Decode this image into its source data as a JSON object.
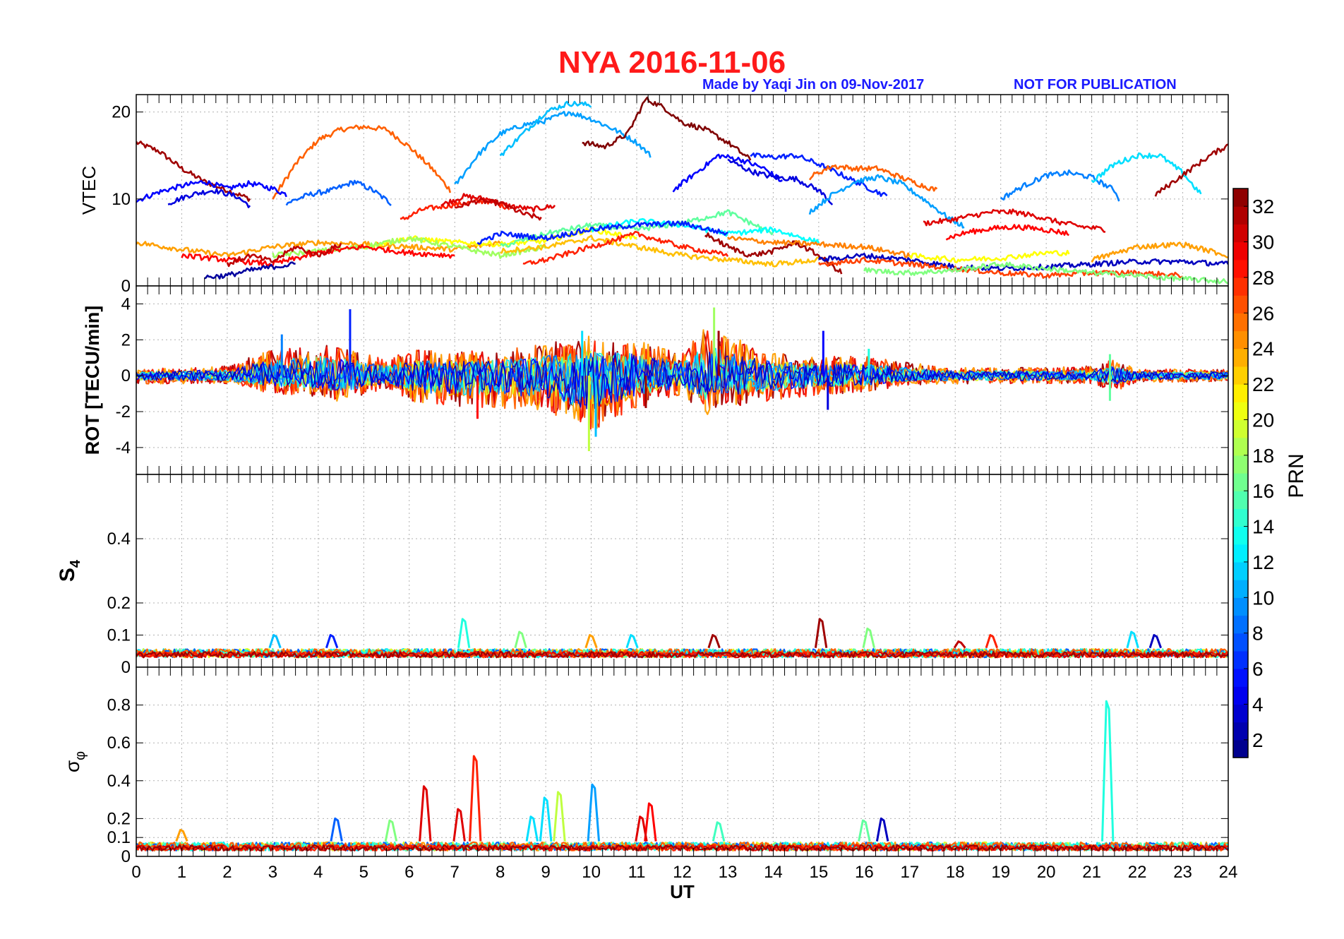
{
  "header": {
    "title": "NYA   2016-11-06",
    "credit": "Made by Yaqi Jin on 09-Nov-2017",
    "notice": "NOT FOR PUBLICATION"
  },
  "colors": {
    "title": "#ff1a1a",
    "credit": "#1a1aff",
    "grid": "#b0b0b0",
    "axis": "#000000"
  },
  "chart_data": [
    {
      "type": "line",
      "panel": "VTEC",
      "ylabel": "VTEC",
      "xlim": [
        0,
        24
      ],
      "ylim": [
        0,
        22
      ],
      "yticks": [
        0,
        10,
        20
      ],
      "grid": true,
      "series": [
        {
          "prn": 32,
          "x": [
            0,
            0.5,
            1,
            1.5,
            2,
            2.5
          ],
          "y": [
            16.5,
            15.5,
            13.5,
            12,
            11,
            10
          ]
        },
        {
          "prn": 26,
          "x": [
            3,
            3.5,
            4,
            4.5,
            5,
            5.5,
            6,
            6.5,
            6.9
          ],
          "y": [
            10,
            14,
            16.8,
            18,
            18.3,
            18,
            16,
            13.5,
            11
          ]
        },
        {
          "prn": 8,
          "x": [
            3.3,
            3.8,
            4.3,
            4.8,
            5.2,
            5.6
          ],
          "y": [
            9.5,
            10.5,
            11,
            12,
            11,
            9.5
          ]
        },
        {
          "prn": 5,
          "x": [
            0,
            0.5,
            1,
            1.5,
            2,
            2.5,
            3,
            3.3
          ],
          "y": [
            9.8,
            10.8,
            11.5,
            12,
            11.2,
            11.8,
            11.2,
            10.5
          ]
        },
        {
          "prn": 4,
          "x": [
            0.7,
            1.2,
            1.7,
            2.2,
            2.5
          ],
          "y": [
            9.5,
            10.5,
            11,
            10.3,
            9.2
          ]
        },
        {
          "prn": 28,
          "x": [
            5.8,
            6.3,
            6.8,
            7.2,
            7.7,
            8.2
          ],
          "y": [
            7.5,
            8.8,
            9.2,
            9.5,
            9.8,
            9
          ]
        },
        {
          "prn": 30,
          "x": [
            6.7,
            7.2,
            7.7,
            8.2,
            8.7,
            9.2
          ],
          "y": [
            9.3,
            10.3,
            10,
            9.2,
            8.8,
            9.2
          ]
        },
        {
          "prn": 31,
          "x": [
            7,
            7.5,
            8,
            8.5,
            8.9
          ],
          "y": [
            9,
            9.8,
            9.5,
            8.3,
            7.8
          ]
        },
        {
          "prn": 10,
          "x": [
            7,
            7.5,
            8,
            8.5,
            9,
            9.5,
            10,
            10.5,
            11,
            11.3
          ],
          "y": [
            11.5,
            15,
            17.5,
            18.5,
            19,
            20,
            19.2,
            18,
            16.5,
            15
          ]
        },
        {
          "prn": 11,
          "x": [
            8,
            8.5,
            9,
            9.5,
            10
          ],
          "y": [
            15,
            17.5,
            20,
            21,
            20.8
          ]
        },
        {
          "prn": 33,
          "x": [
            9.8,
            10.3,
            10.8,
            11.2,
            11.6,
            12,
            12.5,
            13,
            13.5
          ],
          "y": [
            16.5,
            16,
            17.5,
            21.5,
            20.5,
            18.8,
            18,
            16.5,
            14.5
          ]
        },
        {
          "prn": 5,
          "x": [
            11.8,
            12.3,
            12.8,
            13.3,
            13.8,
            14.2
          ],
          "y": [
            11,
            13,
            15,
            14.5,
            13.5,
            12
          ]
        },
        {
          "prn": 4,
          "x": [
            13,
            13.5,
            14,
            14.5,
            15,
            15.3
          ],
          "y": [
            14.5,
            13.2,
            12.5,
            12.3,
            11,
            9.5
          ]
        },
        {
          "prn": 6,
          "x": [
            13.5,
            14,
            14.5,
            15,
            15.5,
            16,
            16.5
          ],
          "y": [
            15,
            14.8,
            15,
            14,
            12.8,
            11.5,
            10.3
          ]
        },
        {
          "prn": 26,
          "x": [
            14.8,
            15.3,
            15.8,
            16.3,
            16.8,
            17.3,
            17.6
          ],
          "y": [
            12.5,
            13.8,
            13.5,
            13.5,
            12.5,
            11.5,
            11
          ]
        },
        {
          "prn": 10,
          "x": [
            14.8,
            15.3,
            15.8,
            16.3,
            16.8,
            17.3,
            17.8,
            18.2
          ],
          "y": [
            8.5,
            10.5,
            12,
            12.5,
            11.8,
            10,
            8,
            6.8
          ]
        },
        {
          "prn": 30,
          "x": [
            17.3,
            17.8,
            18.3,
            18.8,
            19.3,
            19.8,
            20.3,
            20.8,
            21.3
          ],
          "y": [
            7.2,
            7.5,
            8,
            8.5,
            8.5,
            8,
            7.3,
            6.8,
            6.5
          ]
        },
        {
          "prn": 29,
          "x": [
            17.8,
            18.3,
            18.8,
            19.3,
            19.8,
            20.3,
            20.5
          ],
          "y": [
            5.5,
            6.2,
            6.6,
            6.8,
            6.6,
            6.2,
            6
          ]
        },
        {
          "prn": 9,
          "x": [
            19,
            19.5,
            20,
            20.5,
            21,
            21.5,
            21.6
          ],
          "y": [
            10,
            11.5,
            12.7,
            13,
            12.5,
            11,
            10
          ]
        },
        {
          "prn": 12,
          "x": [
            21,
            21.5,
            22,
            22.5,
            23,
            23.4
          ],
          "y": [
            12,
            14,
            15,
            15,
            13,
            10.5
          ]
        },
        {
          "prn": 32,
          "x": [
            22.4,
            22.8,
            23.2,
            23.6,
            24
          ],
          "y": [
            10.5,
            12,
            13.5,
            15,
            16.2
          ]
        },
        {
          "prn": 24,
          "x": [
            0,
            1,
            2,
            3,
            4,
            5,
            6,
            7,
            8
          ],
          "y": [
            5,
            4.2,
            3.5,
            4.5,
            5,
            4.8,
            4.5,
            4.2,
            5
          ]
        },
        {
          "prn": 21,
          "x": [
            5,
            6,
            7,
            8,
            9,
            10,
            11
          ],
          "y": [
            4.5,
            5.5,
            5,
            4.8,
            5.2,
            6.5,
            5.5
          ]
        },
        {
          "prn": 18,
          "x": [
            3,
            4,
            5,
            6,
            7,
            8,
            9
          ],
          "y": [
            3.5,
            4,
            4.5,
            5.5,
            4.5,
            3.5,
            4.5
          ]
        },
        {
          "prn": 16,
          "x": [
            8,
            9,
            10,
            11,
            12,
            13,
            14
          ],
          "y": [
            4.5,
            6,
            7,
            6.5,
            7.2,
            8.5,
            6
          ]
        },
        {
          "prn": 13,
          "x": [
            10,
            11,
            12,
            13,
            14,
            15
          ],
          "y": [
            6.5,
            7.5,
            7,
            6,
            6.5,
            5
          ]
        },
        {
          "prn": 29,
          "x": [
            1,
            2,
            3,
            4,
            5,
            6,
            7
          ],
          "y": [
            3.5,
            3,
            2.5,
            3.8,
            4.5,
            3.8,
            3.5
          ]
        },
        {
          "prn": 31,
          "x": [
            2,
            2.5,
            3,
            3.5,
            4,
            4.5
          ],
          "y": [
            2.5,
            3.5,
            2.8,
            4.5,
            3.5,
            4.8
          ]
        },
        {
          "prn": 2,
          "x": [
            1.5,
            2,
            2.5,
            3,
            3.5
          ],
          "y": [
            1,
            1.2,
            1.8,
            2.2,
            2.5
          ]
        },
        {
          "prn": 6,
          "x": [
            7.5,
            8,
            9,
            10,
            11,
            12,
            13
          ],
          "y": [
            5,
            6,
            5.5,
            6.5,
            7,
            7.2,
            6
          ]
        },
        {
          "prn": 23,
          "x": [
            8,
            9,
            10,
            11,
            12,
            13,
            14,
            15
          ],
          "y": [
            4,
            4.5,
            5.5,
            4.5,
            3.5,
            3,
            2.5,
            3
          ]
        },
        {
          "prn": 28,
          "x": [
            8.5,
            9,
            10,
            11,
            12,
            13
          ],
          "y": [
            2.5,
            3,
            4.5,
            6,
            4.5,
            3.5
          ]
        },
        {
          "prn": 32,
          "x": [
            12.5,
            13,
            13.5,
            14,
            14.5,
            15,
            15.5
          ],
          "y": [
            6,
            4.5,
            3.5,
            4,
            5,
            3.5,
            1.5
          ]
        },
        {
          "prn": 25,
          "x": [
            13,
            14,
            15,
            16,
            17
          ],
          "y": [
            5.5,
            5,
            4.8,
            4.5,
            3.5
          ]
        },
        {
          "prn": 3,
          "x": [
            15,
            16,
            17,
            18,
            19,
            20,
            21,
            22,
            23,
            24
          ],
          "y": [
            3,
            3.5,
            3,
            2.2,
            2,
            2.2,
            2.5,
            2.8,
            2.8,
            2.5
          ]
        },
        {
          "prn": 27,
          "x": [
            15,
            16,
            17,
            18,
            19,
            20,
            21,
            22,
            23
          ],
          "y": [
            2.5,
            3,
            2.5,
            2,
            1.5,
            1.2,
            1.5,
            1.5,
            1.2
          ]
        },
        {
          "prn": 21,
          "x": [
            17,
            18,
            19,
            20,
            20.5
          ],
          "y": [
            3.5,
            3,
            3.2,
            3.8,
            3.8
          ]
        },
        {
          "prn": 17,
          "x": [
            16,
            17,
            18,
            19,
            20,
            21,
            22,
            23,
            24
          ],
          "y": [
            1.8,
            1.5,
            1.8,
            2.5,
            2,
            1.5,
            1.2,
            0.8,
            0.5
          ]
        },
        {
          "prn": 24,
          "x": [
            21,
            22,
            23,
            24
          ],
          "y": [
            3,
            4.5,
            4.8,
            3.5
          ]
        }
      ]
    },
    {
      "type": "line",
      "panel": "ROT",
      "ylabel": "ROT [TECU/min]",
      "xlim": [
        0,
        24
      ],
      "ylim": [
        -5.5,
        5
      ],
      "yticks": [
        -4,
        -2,
        0,
        2,
        4
      ],
      "grid": true,
      "envelope_times": [
        0,
        2,
        2.8,
        4,
        4.5,
        5.5,
        6,
        7,
        8,
        9,
        10,
        11,
        12,
        12.5,
        13,
        14,
        15,
        16,
        17,
        18,
        20,
        21,
        21.5,
        22,
        24
      ],
      "envelope_up": [
        0.4,
        0.6,
        1.5,
        2,
        1.8,
        1,
        1.6,
        1.5,
        1.6,
        2,
        2.5,
        2.2,
        1.4,
        3,
        2.5,
        1.4,
        1.2,
        1.2,
        0.8,
        0.5,
        0.5,
        0.6,
        1,
        0.4,
        0.4
      ],
      "envelope_down": [
        0.5,
        0.5,
        1,
        1.4,
        1.6,
        0.8,
        1.6,
        2,
        2,
        2.2,
        3.5,
        2,
        1.2,
        2.5,
        2,
        1.5,
        1.2,
        1,
        0.6,
        0.5,
        0.5,
        0.5,
        1,
        0.4,
        0.4
      ],
      "spikes": [
        {
          "prn": 6,
          "x": 4.7,
          "y": 3.7
        },
        {
          "prn": 18,
          "x": 12.7,
          "y": 3.8
        },
        {
          "prn": 32,
          "x": 12.8,
          "y": 2.5
        },
        {
          "prn": 19,
          "x": 9.95,
          "y": -4.2
        },
        {
          "prn": 11,
          "x": 10.1,
          "y": -3.4
        },
        {
          "prn": 12,
          "x": 9.8,
          "y": 2.5
        },
        {
          "prn": 29,
          "x": 7.5,
          "y": -2.4
        },
        {
          "prn": 5,
          "x": 15.1,
          "y": 2.5
        },
        {
          "prn": 4,
          "x": 15.2,
          "y": -1.9
        },
        {
          "prn": 32,
          "x": 11.2,
          "y": -1.8
        },
        {
          "prn": 16,
          "x": 21.4,
          "y": 1.2
        },
        {
          "prn": 16,
          "x": 21.4,
          "y": -1.4
        },
        {
          "prn": 9,
          "x": 3.2,
          "y": 2.3
        },
        {
          "prn": 14,
          "x": 16.1,
          "y": 1.5
        }
      ]
    },
    {
      "type": "line",
      "panel": "S4",
      "ylabel": "S4",
      "xlim": [
        0,
        24
      ],
      "ylim": [
        0,
        0.6
      ],
      "yticks": [
        0,
        0.1,
        0.2,
        0.4
      ],
      "grid": true,
      "baseline": [
        0.03,
        0.06
      ],
      "peaks": [
        {
          "prn": 11,
          "x": 3.05,
          "y": 0.1
        },
        {
          "prn": 6,
          "x": 4.3,
          "y": 0.1
        },
        {
          "prn": 14,
          "x": 7.2,
          "y": 0.15
        },
        {
          "prn": 17,
          "x": 8.45,
          "y": 0.11
        },
        {
          "prn": 24,
          "x": 10,
          "y": 0.1
        },
        {
          "prn": 12,
          "x": 10.9,
          "y": 0.1
        },
        {
          "prn": 32,
          "x": 12.7,
          "y": 0.1
        },
        {
          "prn": 32,
          "x": 15.05,
          "y": 0.15
        },
        {
          "prn": 17,
          "x": 16.1,
          "y": 0.12
        },
        {
          "prn": 31,
          "x": 18.1,
          "y": 0.08
        },
        {
          "prn": 28,
          "x": 18.8,
          "y": 0.1
        },
        {
          "prn": 12,
          "x": 21.9,
          "y": 0.11
        },
        {
          "prn": 3,
          "x": 22.4,
          "y": 0.1
        }
      ]
    },
    {
      "type": "line",
      "panel": "sigma_phi",
      "ylabel": "σφ",
      "xlim": [
        0,
        24
      ],
      "ylim": [
        0,
        1
      ],
      "yticks": [
        0,
        0.1,
        0.2,
        0.4,
        0.6,
        0.8
      ],
      "xticks": [
        0,
        1,
        2,
        3,
        4,
        5,
        6,
        7,
        8,
        9,
        10,
        11,
        12,
        13,
        14,
        15,
        16,
        17,
        18,
        19,
        20,
        21,
        22,
        23,
        24
      ],
      "xlabel": "UT",
      "grid": true,
      "baseline": [
        0.03,
        0.08
      ],
      "peaks": [
        {
          "prn": 14,
          "x": 21.35,
          "y": 0.82
        },
        {
          "prn": 28,
          "x": 7.45,
          "y": 0.53
        },
        {
          "prn": 30,
          "x": 6.35,
          "y": 0.37
        },
        {
          "prn": 10,
          "x": 10.05,
          "y": 0.38
        },
        {
          "prn": 19,
          "x": 9.3,
          "y": 0.34
        },
        {
          "prn": 12,
          "x": 9.0,
          "y": 0.31
        },
        {
          "prn": 30,
          "x": 7.1,
          "y": 0.25
        },
        {
          "prn": 29,
          "x": 11.3,
          "y": 0.28
        },
        {
          "prn": 30,
          "x": 11.1,
          "y": 0.21
        },
        {
          "prn": 8,
          "x": 4.4,
          "y": 0.2
        },
        {
          "prn": 17,
          "x": 5.6,
          "y": 0.19
        },
        {
          "prn": 12,
          "x": 8.7,
          "y": 0.21
        },
        {
          "prn": 3,
          "x": 16.4,
          "y": 0.2
        },
        {
          "prn": 16,
          "x": 16.0,
          "y": 0.19
        },
        {
          "prn": 15,
          "x": 12.8,
          "y": 0.18
        },
        {
          "prn": 24,
          "x": 1.0,
          "y": 0.14
        }
      ]
    },
    {
      "type": "heatmap",
      "panel": "colorbar",
      "label": "PRN",
      "range": [
        1,
        33
      ],
      "ticks": [
        2,
        4,
        6,
        8,
        10,
        12,
        14,
        16,
        18,
        20,
        22,
        24,
        26,
        28,
        30,
        32
      ],
      "colormap": "jet"
    }
  ]
}
